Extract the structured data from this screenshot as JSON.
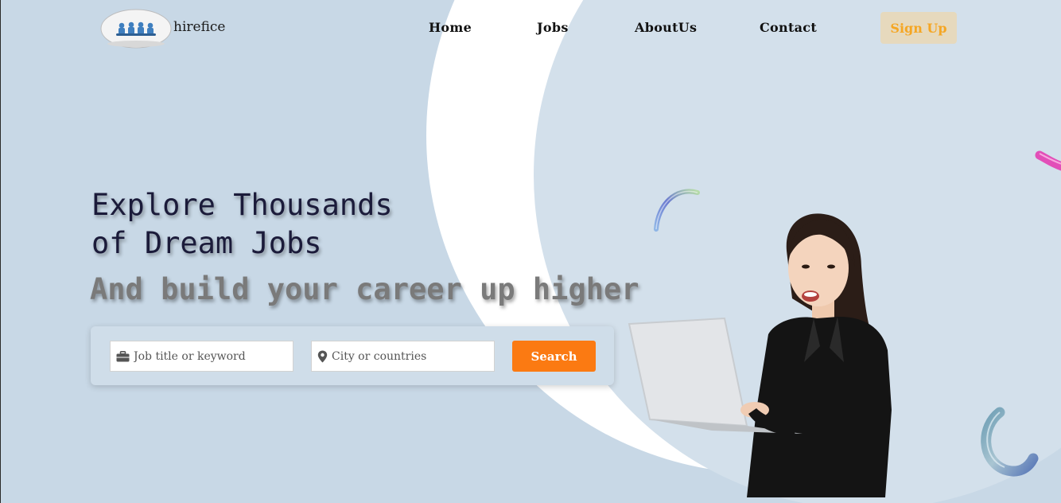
{
  "brand": {
    "name": "hirefice",
    "logo_icon": "people-group-logo"
  },
  "nav": {
    "items": [
      {
        "label": "Home"
      },
      {
        "label": "Jobs"
      },
      {
        "label": "AboutUs"
      },
      {
        "label": "Contact"
      }
    ],
    "signup_label": "Sign Up"
  },
  "hero": {
    "headline_line1": "Explore Thousands",
    "headline_line2": "of Dream Jobs",
    "tagline": "And build your career up higher"
  },
  "search": {
    "job_placeholder": "Job title or keyword",
    "job_icon": "briefcase-icon",
    "location_placeholder": "City or countries",
    "location_icon": "map-pin-icon",
    "button_label": "Search"
  },
  "colors": {
    "background": "#c8d8e6",
    "accent": "#fb7a12",
    "signup_bg": "#e6d9bd",
    "signup_text": "#f5a623"
  }
}
